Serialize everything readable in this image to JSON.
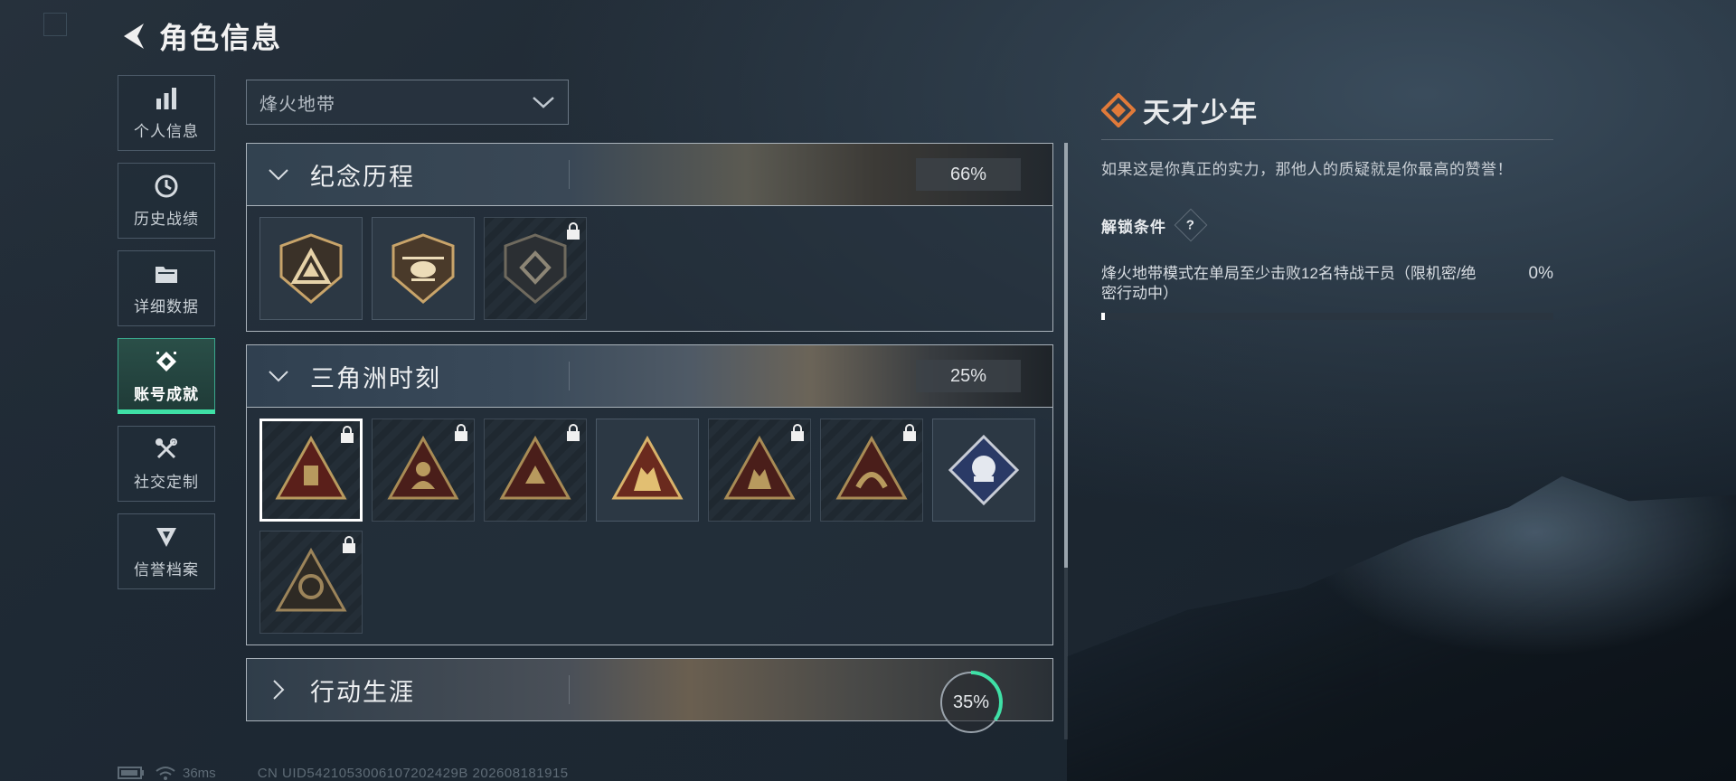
{
  "header": {
    "title": "角色信息"
  },
  "nav": {
    "items": [
      {
        "label": "个人信息",
        "icon": "bar-chart-icon"
      },
      {
        "label": "历史战绩",
        "icon": "clock-icon"
      },
      {
        "label": "详细数据",
        "icon": "folder-icon"
      },
      {
        "label": "账号成就",
        "icon": "achievement-icon",
        "active": true
      },
      {
        "label": "社交定制",
        "icon": "tools-icon"
      },
      {
        "label": "信誉档案",
        "icon": "shield-icon"
      }
    ]
  },
  "mode_select": {
    "value": "烽火地带"
  },
  "sections": [
    {
      "title": "纪念历程",
      "progress": "66%"
    },
    {
      "title": "三角洲时刻",
      "progress": "25%"
    },
    {
      "title": "行动生涯",
      "progress": "35%",
      "progress_fraction": 0.35
    }
  ],
  "detail": {
    "name": "天才少年",
    "description": "如果这是你真正的实力，那他人的质疑就是你最高的赞誉！",
    "unlock_title": "解锁条件",
    "help_label": "?",
    "condition": "烽火地带模式在单局至少击败12名特战干员（限机密/绝密行动中）",
    "condition_progress": "0%",
    "condition_fraction": 0.0
  },
  "status": {
    "ping": "36ms",
    "uid": "CN UID5421053006107202429B 202608181915"
  },
  "colors": {
    "accent": "#3fe0a6",
    "brand_orange": "#e07a3a",
    "gold": "#c8a46a"
  }
}
